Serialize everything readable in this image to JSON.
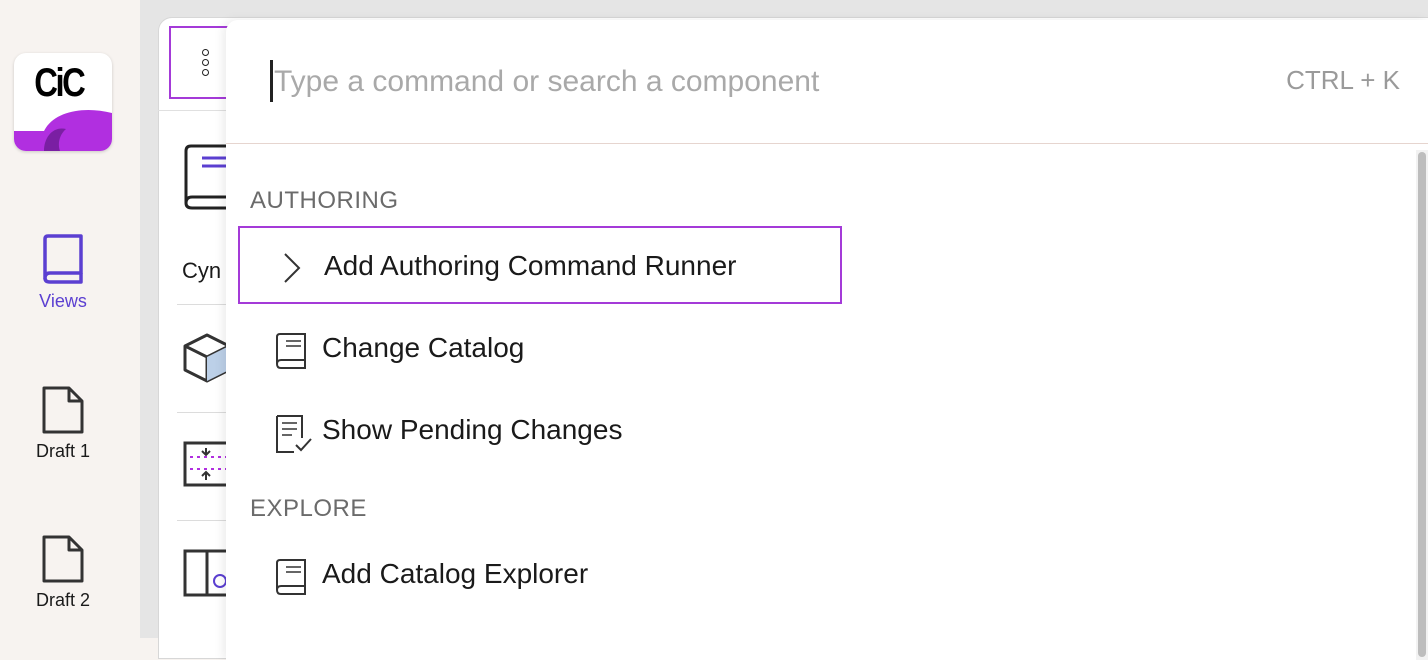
{
  "app": {
    "logo_text": "CiC"
  },
  "nav": {
    "items": [
      {
        "label": "Views",
        "icon": "book-icon",
        "active": true
      },
      {
        "label": "Draft 1",
        "icon": "document-icon",
        "active": false
      },
      {
        "label": "Draft 2",
        "icon": "document-icon",
        "active": false
      }
    ]
  },
  "background_list": {
    "visible_text": "Cyn"
  },
  "palette": {
    "search": {
      "value": "",
      "placeholder": "Type a command or search a component"
    },
    "shortcut": "CTRL + K",
    "sections": [
      {
        "title": "AUTHORING",
        "items": [
          {
            "label": "Add Authoring Command Runner",
            "icon": "chevron-right-icon",
            "selected": true
          },
          {
            "label": "Change Catalog",
            "icon": "book-icon",
            "selected": false
          },
          {
            "label": "Show Pending Changes",
            "icon": "checklist-icon",
            "selected": false
          }
        ]
      },
      {
        "title": "EXPLORE",
        "items": [
          {
            "label": "Add Catalog Explorer",
            "icon": "book-icon",
            "selected": false
          }
        ]
      }
    ]
  },
  "colors": {
    "accent_purple": "#a43ad8",
    "nav_active": "#5b3fd1",
    "logo_magenta": "#b12fe0"
  }
}
